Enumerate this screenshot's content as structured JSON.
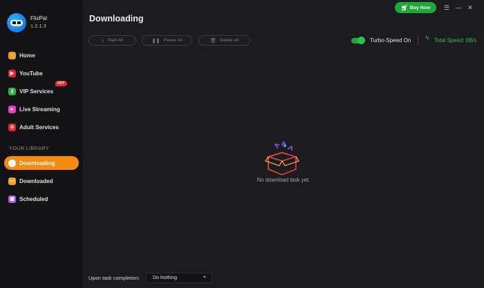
{
  "app": {
    "name": "FlixPal",
    "version": "1.2.1.3"
  },
  "nav": {
    "items": [
      {
        "label": "Home",
        "icon": "home-icon",
        "color": "#f39c1f"
      },
      {
        "label": "YouTube",
        "icon": "youtube-icon",
        "color": "#e8262d"
      },
      {
        "label": "VIP Services",
        "icon": "key-icon",
        "color": "#2bb24a",
        "badge": "HOT"
      },
      {
        "label": "Live Streaming",
        "icon": "live-icon",
        "color": "#e83ec8"
      },
      {
        "label": "Adult Services",
        "icon": "adult-icon",
        "color": "#e8262d"
      }
    ],
    "library_label": "YOUR LIBRARY",
    "library": [
      {
        "label": "Downloading",
        "icon": "download-icon",
        "active": true
      },
      {
        "label": "Downloaded",
        "icon": "folder-icon",
        "color": "#f39c1f"
      },
      {
        "label": "Scheduled",
        "icon": "calendar-icon",
        "color": "#9b5cf0"
      }
    ]
  },
  "header": {
    "title": "Downloading",
    "buy_label": "Buy Now",
    "buy_color": "#21a83c"
  },
  "toolbar": {
    "start_all": "Start All",
    "pause_all": "Pause All",
    "delete_all": "Delete All",
    "turbo_label": "Turbo-Speed On",
    "turbo_enabled": true,
    "speed_label": "Total Speed: 0B/s"
  },
  "empty": {
    "message": "No download task yet."
  },
  "footer": {
    "completion_label": "Upon task completion:",
    "completion_value": "Do Nothing"
  },
  "colors": {
    "accent": "#f48a12",
    "green": "#21a83c"
  }
}
